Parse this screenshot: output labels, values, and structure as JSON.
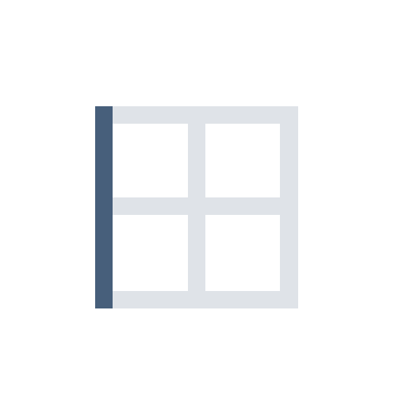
{
  "icon": {
    "name": "border-left-icon",
    "colors": {
      "grid": "#DFE3E8",
      "left_border": "#475F7B",
      "background": "#FFFFFF"
    }
  }
}
